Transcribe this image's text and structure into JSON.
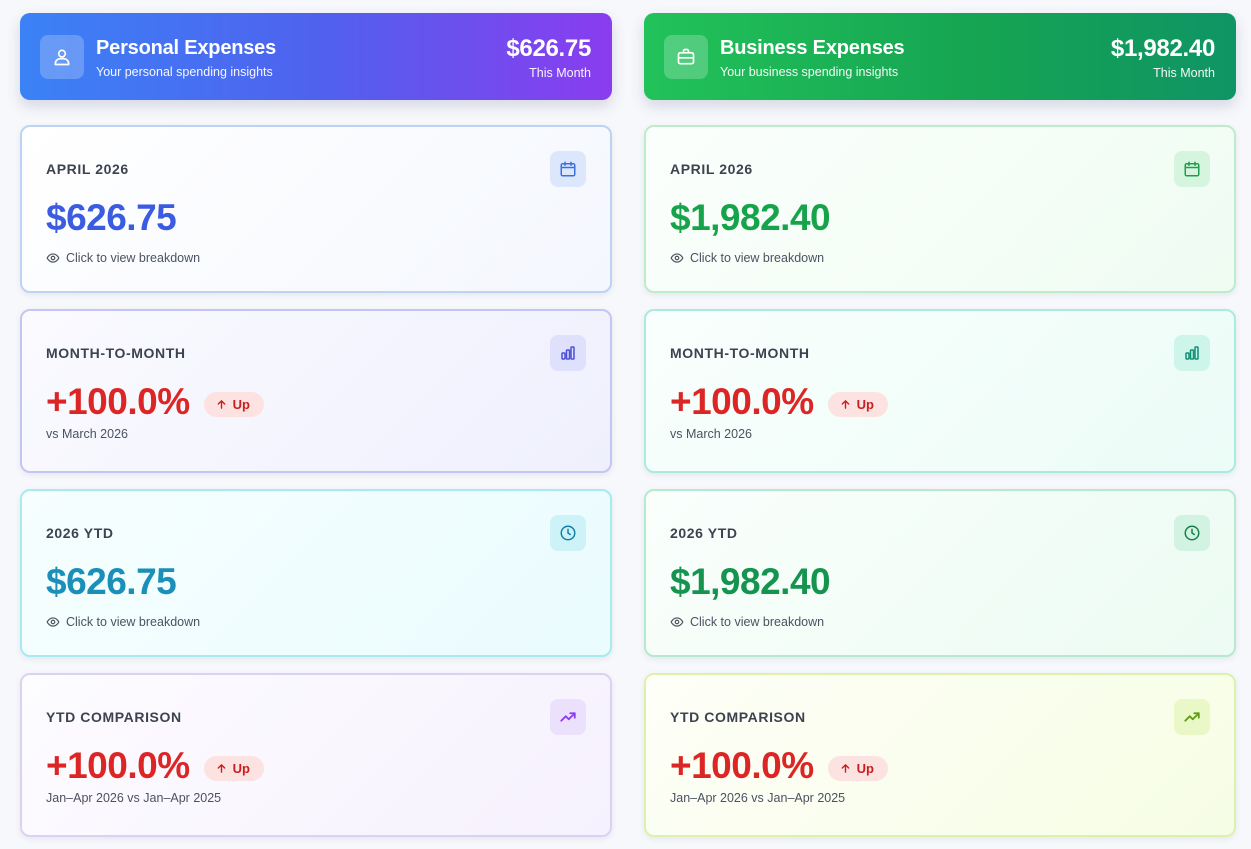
{
  "personal": {
    "title": "Personal Expenses",
    "subtitle": "Your personal spending insights",
    "amount": "$626.75",
    "period": "This Month",
    "cards": {
      "month": {
        "label": "APRIL 2026",
        "value": "$626.75",
        "note": "Click to view breakdown"
      },
      "mtm": {
        "label": "MONTH-TO-MONTH",
        "value": "+100.0%",
        "badge": "Up",
        "sub": "vs March 2026"
      },
      "ytd": {
        "label": "2026 YTD",
        "value": "$626.75",
        "note": "Click to view breakdown"
      },
      "ytdcmp": {
        "label": "YTD COMPARISON",
        "value": "+100.0%",
        "badge": "Up",
        "sub": "Jan–Apr 2026 vs Jan–Apr 2025"
      }
    }
  },
  "business": {
    "title": "Business Expenses",
    "subtitle": "Your business spending insights",
    "amount": "$1,982.40",
    "period": "This Month",
    "cards": {
      "month": {
        "label": "APRIL 2026",
        "value": "$1,982.40",
        "note": "Click to view breakdown"
      },
      "mtm": {
        "label": "MONTH-TO-MONTH",
        "value": "+100.0%",
        "badge": "Up",
        "sub": "vs March 2026"
      },
      "ytd": {
        "label": "2026 YTD",
        "value": "$1,982.40",
        "note": "Click to view breakdown"
      },
      "ytdcmp": {
        "label": "YTD COMPARISON",
        "value": "+100.0%",
        "badge": "Up",
        "sub": "Jan–Apr 2026 vs Jan–Apr 2025"
      }
    }
  },
  "colors": {
    "personal_value": "#3b5be0",
    "personal_ytd_value": "#1a8fb8",
    "business_value": "#16a34a",
    "business_ytd_value": "#15944f",
    "negative_trend": "#dc2626"
  },
  "icons": {
    "personal_header": "user-icon",
    "business_header": "briefcase-icon",
    "month": "calendar-icon",
    "mtm": "bar-chart-icon",
    "ytd": "clock-icon",
    "ytdcmp": "trending-up-icon",
    "note": "eye-icon",
    "badge": "arrow-up-icon"
  }
}
